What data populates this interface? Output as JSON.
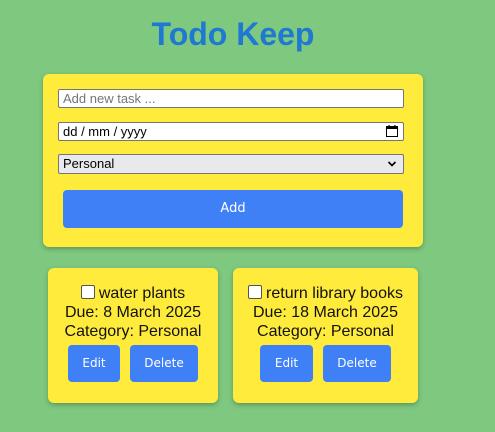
{
  "app": {
    "title": "Todo Keep"
  },
  "form": {
    "task_placeholder": "Add new task ...",
    "date_placeholder": "dd / mm / yyyy",
    "category_selected": "Personal",
    "add_label": "Add"
  },
  "tasks": [
    {
      "name": "water plants",
      "due": "Due: 8 March 2025",
      "category": "Category: Personal",
      "completed": false,
      "edit_label": "Edit",
      "delete_label": "Delete"
    },
    {
      "name": "return library books",
      "due": "Due: 18 March 2025",
      "category": "Category: Personal",
      "completed": false,
      "edit_label": "Edit",
      "delete_label": "Delete"
    }
  ],
  "colors": {
    "background": "#7ec87f",
    "card": "#ffeb3b",
    "button": "#3f80f7",
    "title": "#1f78d1"
  },
  "icons": {
    "date": "calendar-icon",
    "select": "chevron-down-icon"
  }
}
